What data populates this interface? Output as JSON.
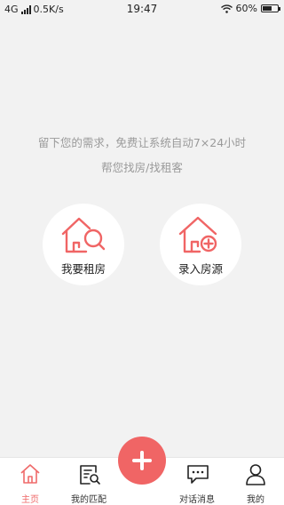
{
  "status": {
    "network": "4G",
    "speed": "0.5K/s",
    "time": "19:47",
    "battery": "60%",
    "battery_level": 0.6
  },
  "tagline": {
    "line1": "留下您的需求，免费让系统自动7×24小时",
    "line2": "帮您找房/找租客"
  },
  "actions": {
    "rent_label": "我要租房",
    "enter_label": "录入房源"
  },
  "tabs": {
    "home": "主页",
    "match": "我的匹配",
    "messages": "对话消息",
    "me": "我的"
  },
  "colors": {
    "accent": "#f06565",
    "background": "#f2f2f2"
  },
  "icons": [
    "house-search-icon",
    "house-add-icon",
    "home-icon",
    "match-document-icon",
    "chat-icon",
    "user-icon",
    "plus-icon"
  ]
}
